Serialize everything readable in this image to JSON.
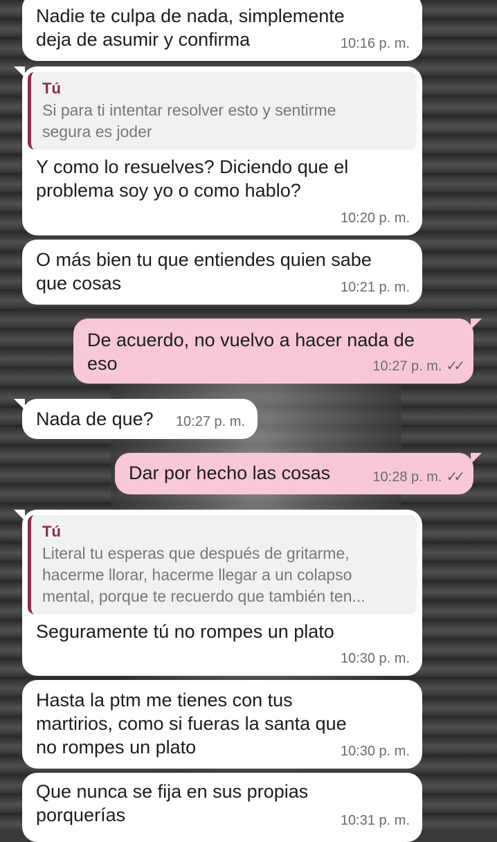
{
  "messages": [
    {
      "text": "Nadie te culpa de nada, simplemente\ndeja de asumir y confirma",
      "time": "10:16 p. m."
    },
    {
      "quote_author": "Tú",
      "quote_text": "Si para ti intentar resolver esto y sentirme\nsegura es joder",
      "text": "Y como lo resuelves? Diciendo que el\nproblema soy yo o como hablo?",
      "time": "10:20 p. m."
    },
    {
      "text": "O más bien tu que entiendes quien sabe\nque cosas",
      "time": "10:21 p. m."
    },
    {
      "text": "De acuerdo, no vuelvo a hacer nada de\neso",
      "time": "10:27 p. m."
    },
    {
      "text": "Nada de que?",
      "time": "10:27 p. m."
    },
    {
      "text": "Dar por hecho las cosas",
      "time": "10:28 p. m."
    },
    {
      "quote_author": "Tú",
      "quote_text": "Literal tu esperas que después de gritarme,\nhacerme llorar, hacerme llegar a un colapso\nmental, porque te recuerdo que también ten...",
      "text": "Seguramente tú no rompes un plato",
      "time": "10:30 p. m."
    },
    {
      "text": "Hasta la ptm me tienes con tus\nmartirios, como si fueras la santa que\nno rompes un plato",
      "time": "10:30 p. m."
    },
    {
      "text": "Que nunca se fija en sus propias\nporquerías",
      "time": "10:31 p. m."
    }
  ],
  "read_icon": "double-check-icon",
  "colors": {
    "incoming": "#ffffff",
    "outgoing": "#f8c8d6",
    "quote_bar": "#8a2c45"
  }
}
